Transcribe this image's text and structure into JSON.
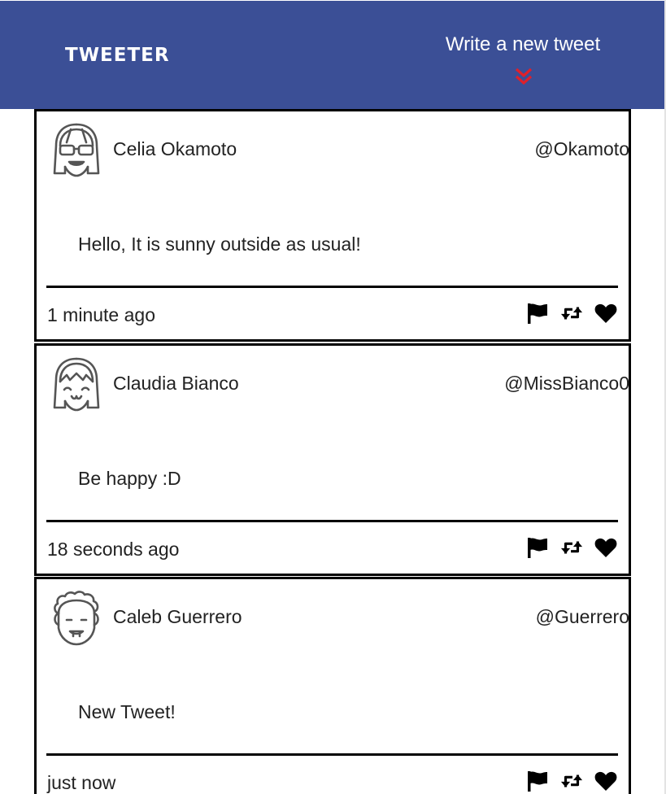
{
  "navbar": {
    "brand": "TWEETER",
    "compose_label": "Write a new tweet",
    "chevron_icon": "double-chevron-down-icon",
    "chevron_color": "#e0202a",
    "background": "#3b4f96"
  },
  "tweets": [
    {
      "avatar_icon": "avatar-girl-sunglasses-icon",
      "name": "Celia Okamoto",
      "handle": "@Okamoto",
      "text": "Hello, It is sunny outside as usual!",
      "time": "1 minute ago"
    },
    {
      "avatar_icon": "avatar-girl-bangs-icon",
      "name": "Claudia Bianco",
      "handle": "@MissBianco0",
      "text": "Be happy :D",
      "time": "18 seconds ago"
    },
    {
      "avatar_icon": "avatar-curly-hair-icon",
      "name": "Caleb Guerrero",
      "handle": "@Guerrero",
      "text": "New Tweet!",
      "time": "just now"
    }
  ],
  "actions": {
    "flag_icon": "flag-icon",
    "retweet_icon": "retweet-icon",
    "like_icon": "heart-icon"
  }
}
